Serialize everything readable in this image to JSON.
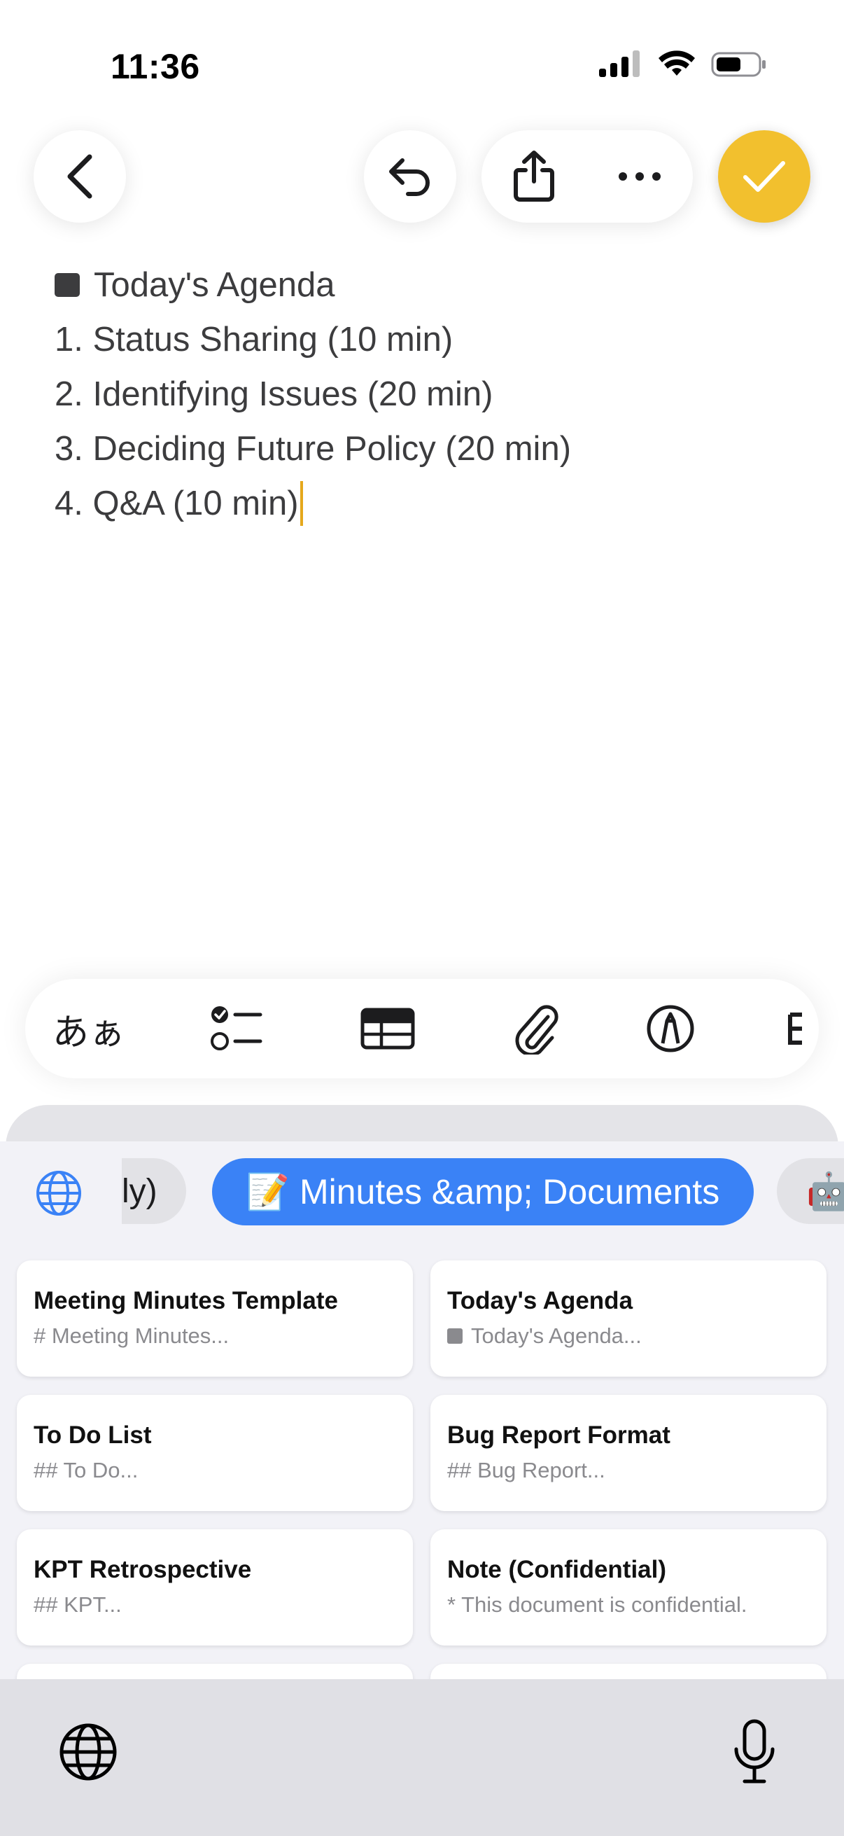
{
  "status_bar": {
    "time": "11:36"
  },
  "note": {
    "heading": "Today's Agenda",
    "lines": [
      "1. Status Sharing (10 min)",
      "2. Identifying Issues (20 min)",
      "3. Deciding Future Policy (20 min)",
      "4. Q&A (10 min)"
    ]
  },
  "toolbar": {
    "text_style_label": "あぁ"
  },
  "chips": {
    "previous_partial": "ly)",
    "active": "📝 Minutes &amp; Documents",
    "next_emoji": "🤖"
  },
  "templates": [
    {
      "title": "Meeting Minutes Template",
      "preview": "# Meeting Minutes..."
    },
    {
      "title": "Today's Agenda",
      "preview": "Today's Agenda..."
    },
    {
      "title": "To Do List",
      "preview": "## To Do..."
    },
    {
      "title": "Bug Report Format",
      "preview": "## Bug Report..."
    },
    {
      "title": "KPT Retrospective",
      "preview": "## KPT..."
    },
    {
      "title": "Note (Confidential)",
      "preview": "* This document is confidential."
    }
  ],
  "colors": {
    "accent": "#f2c02e",
    "chip_active": "#3a82f6",
    "caret": "#e5a81c"
  }
}
